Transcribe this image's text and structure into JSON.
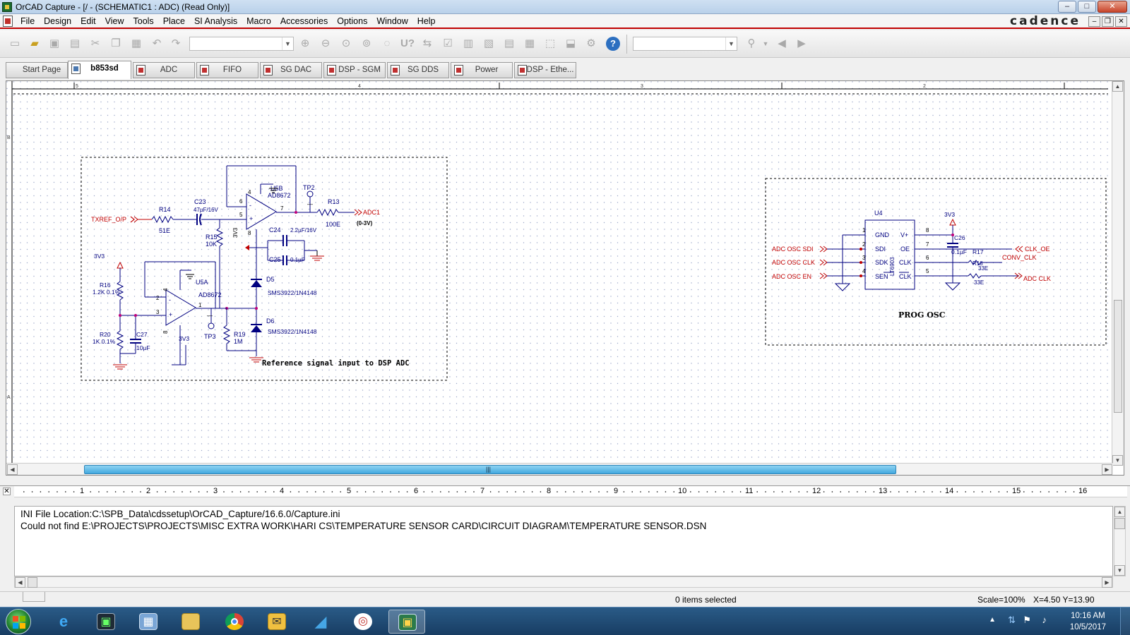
{
  "window": {
    "title": "OrCAD Capture - [/ - (SCHEMATIC1 : ADC) (Read Only)]",
    "brand": "cadence",
    "min": "–",
    "max": "□",
    "close": "✕",
    "mdi_min": "–",
    "mdi_restore": "❐",
    "mdi_close": "✕"
  },
  "menu": [
    "File",
    "Design",
    "Edit",
    "View",
    "Tools",
    "Place",
    "SI Analysis",
    "Macro",
    "Accessories",
    "Options",
    "Window",
    "Help"
  ],
  "toolbar": {
    "part_combo_value": "",
    "find_combo_value": "",
    "help": "?",
    "icons": [
      "new-icon",
      "open-icon",
      "save-icon",
      "print-icon",
      "cut-icon",
      "copy-icon",
      "paste-icon",
      "undo-icon",
      "redo-icon",
      "zoom-in-icon",
      "zoom-out-icon",
      "zoom-area-icon",
      "zoom-all-icon",
      "select-icon",
      "annotate-icon",
      "back-annotate-icon",
      "drc-icon",
      "netlist-icon",
      "crossref-icon",
      "bom-icon",
      "snap-grid-icon",
      "area-select-icon",
      "drag-connected-icon",
      "project-manager-icon",
      "help-icon",
      "find-icon",
      "prev-icon",
      "next-icon"
    ]
  },
  "tabs": [
    {
      "label": "Start Page",
      "active": false
    },
    {
      "label": "b853sd",
      "active": true
    },
    {
      "label": "ADC",
      "active": false
    },
    {
      "label": "FIFO",
      "active": false
    },
    {
      "label": "SG DAC",
      "active": false
    },
    {
      "label": "DSP - SGM",
      "active": false
    },
    {
      "label": "SG DDS",
      "active": false
    },
    {
      "label": "Power",
      "active": false
    },
    {
      "label": "DSP - Ethe...",
      "active": false
    }
  ],
  "schematic": {
    "ruler_top": [
      "5",
      "4",
      "3",
      "2"
    ],
    "ruler_left": [
      "B",
      "A"
    ],
    "left_block": {
      "caption": "Reference signal input to DSP ADC",
      "nets": {
        "txref": "TXREF_O/P",
        "adc1": "ADC1",
        "adc1_range": "(0-3V)",
        "supply": "3V3"
      },
      "parts": [
        {
          "ref": "R14",
          "value": "51E"
        },
        {
          "ref": "C23",
          "value": "47µF/16V"
        },
        {
          "ref": "R15",
          "value": "10K"
        },
        {
          "ref": "U5B",
          "value": "AD8672"
        },
        {
          "ref": "TP2",
          "value": ""
        },
        {
          "ref": "R13",
          "value": "100E"
        },
        {
          "ref": "C24",
          "value": "2.2µF/16V"
        },
        {
          "ref": "C25",
          "value": "0.1µF"
        },
        {
          "ref": "D5",
          "value": "SMS3922/1N4148"
        },
        {
          "ref": "D6",
          "value": "SMS3922/1N4148"
        },
        {
          "ref": "R16",
          "value": "1.2K 0.1%"
        },
        {
          "ref": "R20",
          "value": "1K 0.1%"
        },
        {
          "ref": "C27",
          "value": "10µF"
        },
        {
          "ref": "U5A",
          "value": "AD8672"
        },
        {
          "ref": "TP3",
          "value": ""
        },
        {
          "ref": "R19",
          "value": "1M"
        }
      ],
      "pins": {
        "u5b_6": "6",
        "u5b_5": "5",
        "u5b_7": "7",
        "u5b_4": "4",
        "u5b_8": "8",
        "u5a_2": "2",
        "u5a_3": "3",
        "u5a_1": "1",
        "u5a_4": "4",
        "u5a_8": "8",
        "label_3v3_rot": "3V3"
      }
    },
    "right_block": {
      "caption": "PROG OSC",
      "chip": {
        "ref": "U4",
        "part": "LT6903",
        "left_pins": [
          "GND",
          "SDI",
          "SDK",
          "SEN"
        ],
        "left_nums": [
          "1",
          "2",
          "3",
          "4"
        ],
        "right_pins": [
          "V+",
          "OE",
          "CLK",
          "CLK"
        ],
        "right_nums": [
          "8",
          "7",
          "6",
          "5"
        ]
      },
      "inputs": [
        "ADC OSC SDI",
        "ADC OSC CLK",
        "ADC OSC EN"
      ],
      "outputs": [
        "CLK_OE",
        "CONV_CLK",
        "ADC CLK"
      ],
      "parts": [
        {
          "ref": "C26",
          "value": "0.1µF"
        },
        {
          "ref": "R17",
          "value": "33E"
        },
        {
          "ref": "R18",
          "value": "33E"
        }
      ],
      "supply": "3V3"
    }
  },
  "log": {
    "ruler": [
      "1",
      "2",
      "3",
      "4",
      "5",
      "6",
      "7",
      "8",
      "9",
      "10",
      "11",
      "12",
      "13",
      "14",
      "15",
      "16"
    ],
    "lines": [
      "INI File Location:C:\\SPB_Data\\cdssetup\\OrCAD_Capture/16.6.0/Capture.ini",
      "Could not find E:\\PROJECTS\\PROJECTS\\MISC EXTRA WORK\\HARI CS\\TEMPERATURE SENSOR CARD\\CIRCUIT DIAGRAM\\TEMPERATURE SENSOR.DSN"
    ]
  },
  "status": {
    "selection": "0 items selected",
    "scale": "Scale=100%",
    "coords": "X=4.50  Y=13.90"
  },
  "taskbar": {
    "apps": [
      "start-orb",
      "internet-explorer",
      "terminal-monitor",
      "control-panel",
      "file-explorer",
      "chrome",
      "outlook",
      "shark-app",
      "fingerprint-app",
      "orcad-capture"
    ],
    "time": "10:16 AM",
    "date": "10/5/2017"
  },
  "colors": {
    "wire": "#000080",
    "net": "#c00000",
    "pin_dot": "#c0007a",
    "border": "#000000"
  }
}
